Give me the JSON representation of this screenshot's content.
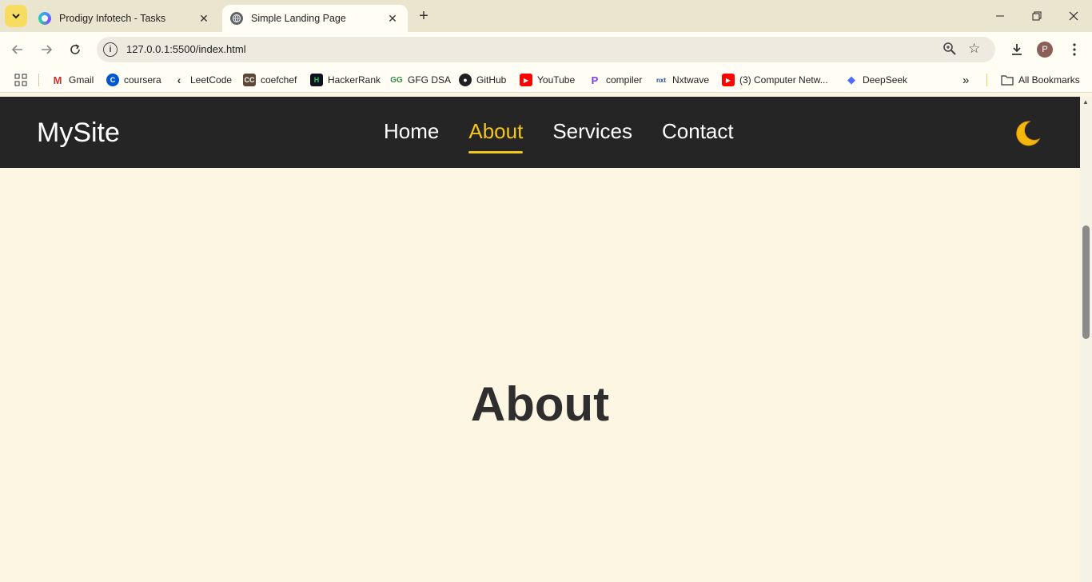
{
  "browser": {
    "tabs": [
      {
        "title": "Prodigy Infotech - Tasks",
        "active": false,
        "favicon": "prodigy-icon"
      },
      {
        "title": "Simple Landing Page",
        "active": true,
        "favicon": "globe-icon"
      }
    ],
    "url": "127.0.0.1:5500/index.html",
    "profile_initial": "P",
    "bookmarks": [
      {
        "label": "Gmail",
        "icon": "gmail-icon"
      },
      {
        "label": "coursera",
        "icon": "coursera-icon"
      },
      {
        "label": "LeetCode",
        "icon": "leetcode-icon"
      },
      {
        "label": "coefchef",
        "icon": "codechef-icon"
      },
      {
        "label": "HackerRank",
        "icon": "hackerrank-icon"
      },
      {
        "label": "GFG DSA",
        "icon": "gfg-icon"
      },
      {
        "label": "GitHub",
        "icon": "github-icon"
      },
      {
        "label": "YouTube",
        "icon": "youtube-icon"
      },
      {
        "label": "compiler",
        "icon": "compiler-icon"
      },
      {
        "label": "Nxtwave",
        "icon": "nxtwave-icon"
      },
      {
        "label": "(3) Computer Netw...",
        "icon": "youtube-icon"
      },
      {
        "label": "DeepSeek",
        "icon": "deepseek-icon"
      }
    ],
    "all_bookmarks_label": "All Bookmarks"
  },
  "site": {
    "logo": "MySite",
    "nav": [
      {
        "label": "Home",
        "active": false
      },
      {
        "label": "About",
        "active": true
      },
      {
        "label": "Services",
        "active": false
      },
      {
        "label": "Contact",
        "active": false
      }
    ],
    "theme_toggle_icon": "moon-icon",
    "hero_heading": "About"
  },
  "colors": {
    "page_bg": "#fdf6e3",
    "nav_bg": "#252525",
    "accent": "#f5c518",
    "heading": "#2e2e2e"
  }
}
